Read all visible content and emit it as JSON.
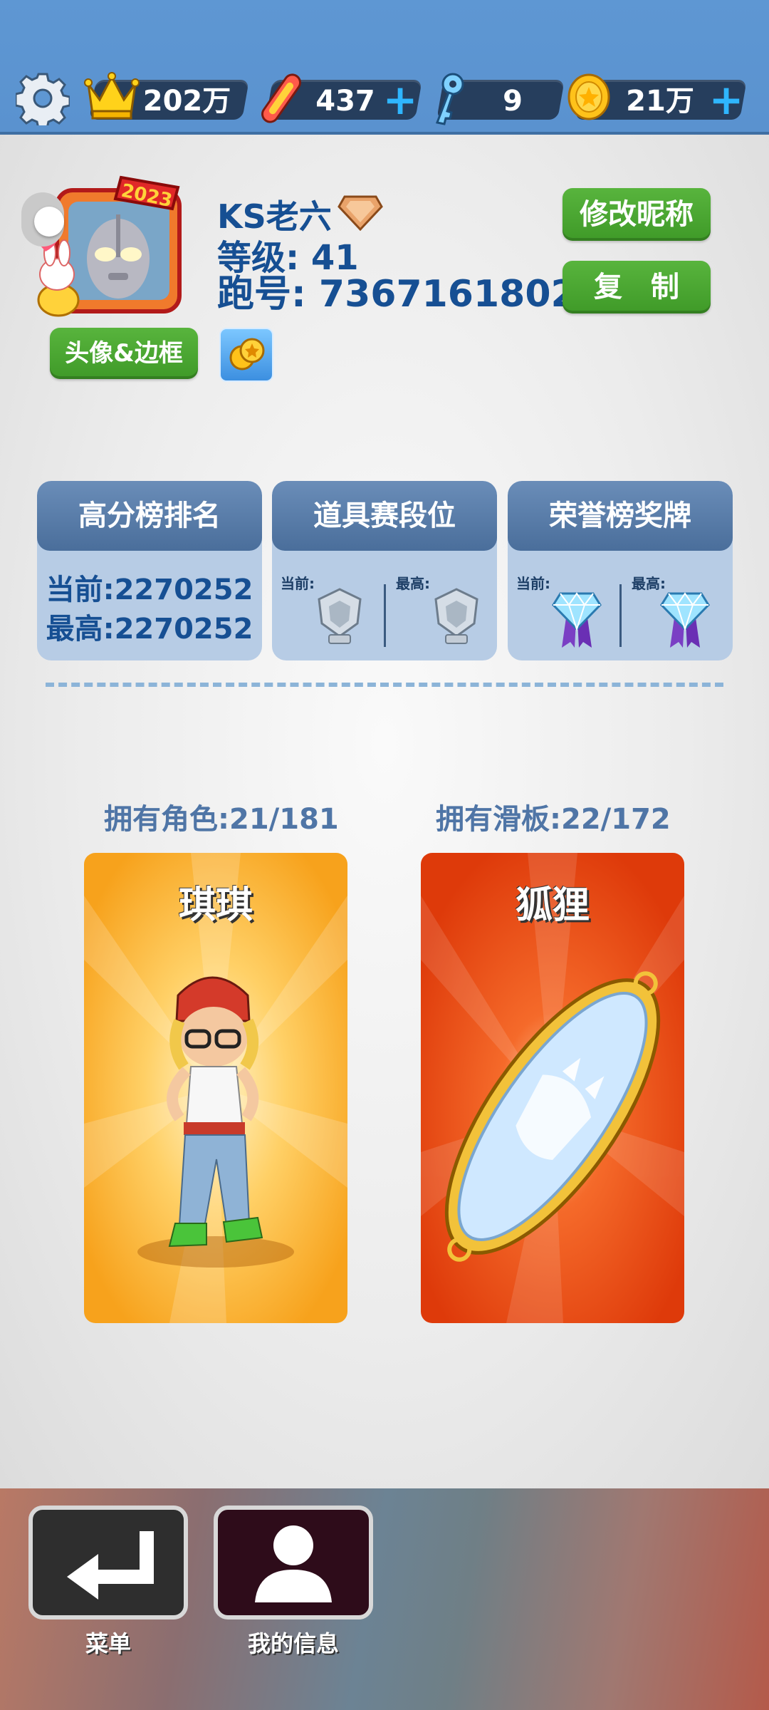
{
  "topbar": {
    "crowns": "202万",
    "boards": "437",
    "keys": "9",
    "coins": "21万",
    "plus_symbol": "+"
  },
  "profile": {
    "avatar_frame_year": "2023",
    "name": "KS老六",
    "level_label": "等级: 41",
    "id_label": "跑号: 7367161802",
    "rename_button": "修改昵称",
    "copy_button": "复　制",
    "avatar_frame_button": "头像&边框"
  },
  "stats": {
    "highscore": {
      "title": "高分榜排名",
      "current": "当前:2270252",
      "best": "最高:2270252"
    },
    "items_tier": {
      "title": "道具赛段位",
      "current_label": "当前:",
      "best_label": "最高:"
    },
    "honor": {
      "title": "荣誉榜奖牌",
      "current_label": "当前:",
      "best_label": "最高:"
    }
  },
  "collection": {
    "characters_owned": "拥有角色:21/181",
    "boards_owned": "拥有滑板:22/172",
    "character_name": "琪琪",
    "board_name": "狐狸"
  },
  "nav": {
    "menu_label": "菜单",
    "myinfo_label": "我的信息"
  },
  "colors": {
    "topbar_blue": "#5e97d3",
    "pill_dark": "#263e5d",
    "accent_green": "#3f9a28",
    "text_blue": "#164f93",
    "card_blue": "#b7cce5",
    "plus_cyan": "#2fb6ff"
  },
  "icons": {
    "settings": "gear-icon",
    "crowns": "crown-icon",
    "boards": "hoverboard-icon",
    "keys": "key-icon",
    "coins": "coin-icon",
    "menu": "return-arrow-icon",
    "myinfo": "person-icon"
  }
}
